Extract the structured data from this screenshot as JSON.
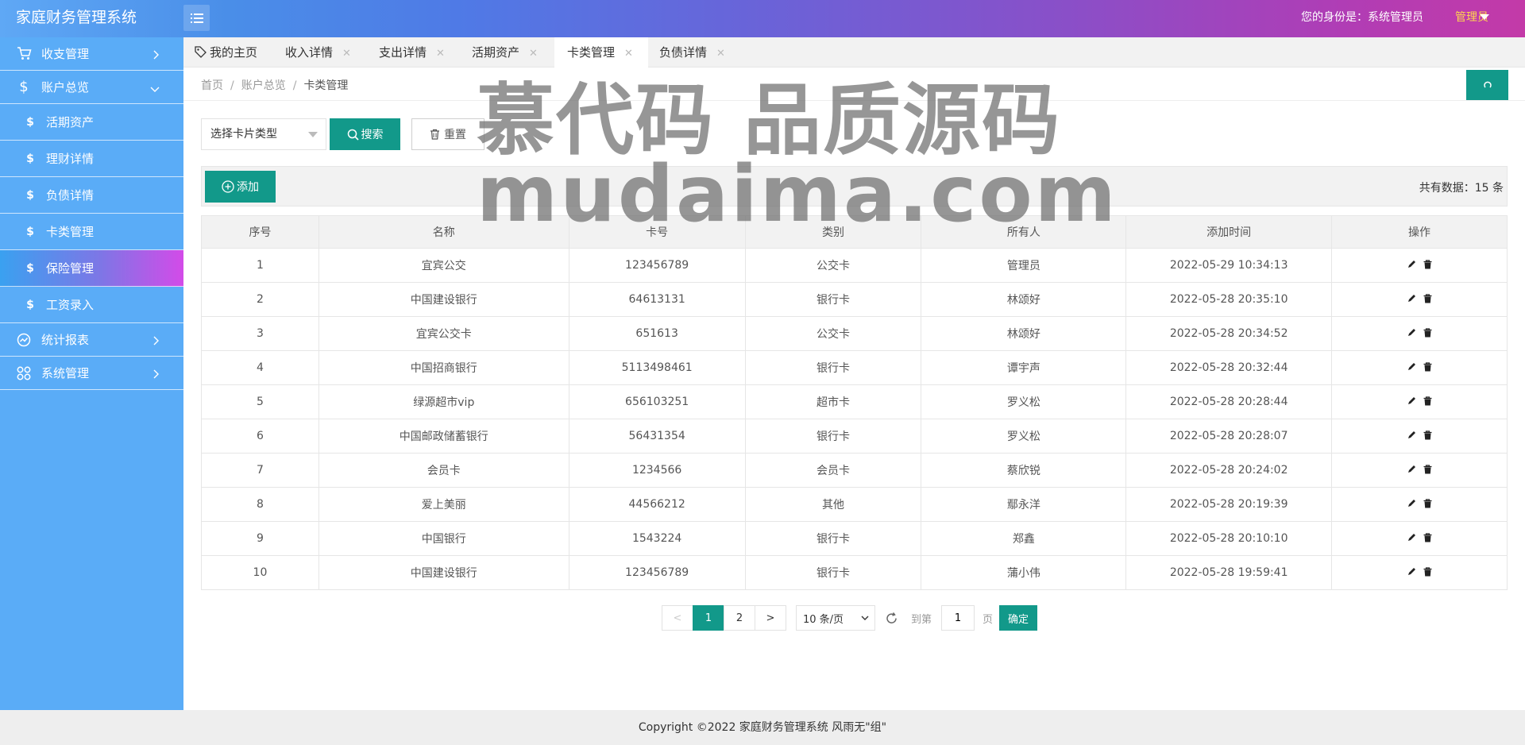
{
  "app": {
    "title": "家庭财务管理系统"
  },
  "header": {
    "identity": "您的身份是：系统管理员",
    "role": "管理员"
  },
  "sidebar": {
    "items": [
      {
        "label": "收支管理",
        "icon": "cart-icon"
      },
      {
        "label": "账户总览",
        "icon": "dollar-icon"
      },
      {
        "label": "活期资产",
        "icon": "dollar-icon"
      },
      {
        "label": "理财详情",
        "icon": "dollar-icon"
      },
      {
        "label": "负债详情",
        "icon": "dollar-icon"
      },
      {
        "label": "卡类管理",
        "icon": "dollar-icon"
      },
      {
        "label": "保险管理",
        "icon": "dollar-icon"
      },
      {
        "label": "工资录入",
        "icon": "dollar-icon"
      },
      {
        "label": "统计报表",
        "icon": "dashboard-icon"
      },
      {
        "label": "系统管理",
        "icon": "grid-icon"
      }
    ],
    "sub_symbol": "$",
    "active": "保险管理"
  },
  "tabs": [
    {
      "label": "我的主页"
    },
    {
      "label": "收入详情"
    },
    {
      "label": "支出详情"
    },
    {
      "label": "活期资产"
    },
    {
      "label": "卡类管理"
    },
    {
      "label": "负债详情"
    }
  ],
  "breadcrumb": {
    "home": "首页",
    "parent": "账户总览",
    "current": "卡类管理"
  },
  "filter": {
    "select_label": "选择卡片类型",
    "search_label": "搜索",
    "reset_label": "重置"
  },
  "toolbar": {
    "add_label": "添加",
    "total_label": "共有数据：15 条"
  },
  "table": {
    "columns": [
      "序号",
      "名称",
      "卡号",
      "类别",
      "所有人",
      "添加时间",
      "操作"
    ],
    "rows": [
      [
        "1",
        "宜宾公交",
        "123456789",
        "公交卡",
        "管理员",
        "2022-05-29 10:34:13"
      ],
      [
        "2",
        "中国建设银行",
        "64613131",
        "银行卡",
        "林颂好",
        "2022-05-28 20:35:10"
      ],
      [
        "3",
        "宜宾公交卡",
        "651613",
        "公交卡",
        "林颂好",
        "2022-05-28 20:34:52"
      ],
      [
        "4",
        "中国招商银行",
        "5113498461",
        "银行卡",
        "谭宇声",
        "2022-05-28 20:32:44"
      ],
      [
        "5",
        "绿源超市vip",
        "656103251",
        "超市卡",
        "罗义松",
        "2022-05-28 20:28:44"
      ],
      [
        "6",
        "中国邮政储蓄银行",
        "56431354",
        "银行卡",
        "罗义松",
        "2022-05-28 20:28:07"
      ],
      [
        "7",
        "会员卡",
        "1234566",
        "会员卡",
        "蔡欣锐",
        "2022-05-28 20:24:02"
      ],
      [
        "8",
        "爱上美丽",
        "44566212",
        "其他",
        "鄢永洋",
        "2022-05-28 20:19:39"
      ],
      [
        "9",
        "中国银行",
        "1543224",
        "银行卡",
        "郑鑫",
        "2022-05-28 20:10:10"
      ],
      [
        "10",
        "中国建设银行",
        "123456789",
        "银行卡",
        "蒲小伟",
        "2022-05-28 19:59:41"
      ]
    ]
  },
  "pagination": {
    "prev": "<",
    "next": ">",
    "pages": [
      "1",
      "2"
    ],
    "current": "1",
    "limit": "10 条/页",
    "goto_label": "到第",
    "goto_value": "1",
    "page_suffix": "页",
    "confirm": "确定"
  },
  "footer": {
    "text": "Copyright ©2022 家庭财务管理系统 风雨无\"组\""
  },
  "watermark": {
    "line1": "慕代码 品质源码",
    "line2": "mudaima.com"
  },
  "colors": {
    "primary": "#12998a",
    "sidebar": "#5aacf7",
    "role": "#ffd54f"
  }
}
